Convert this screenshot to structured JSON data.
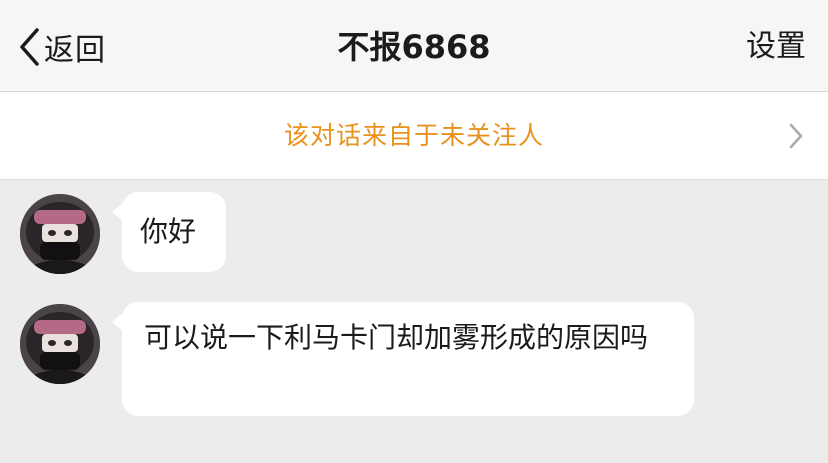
{
  "navbar": {
    "back_label": "返回",
    "title": "不报6868",
    "settings_label": "设置"
  },
  "notice": {
    "text": "该对话来自于未关注人"
  },
  "messages": [
    {
      "text": "你好"
    },
    {
      "text": "可以说一下利马卡门却加雾形成的原因吗"
    }
  ],
  "colors": {
    "notice_text": "#e8911c",
    "chat_background": "#ececec",
    "bubble": "#ffffff"
  }
}
